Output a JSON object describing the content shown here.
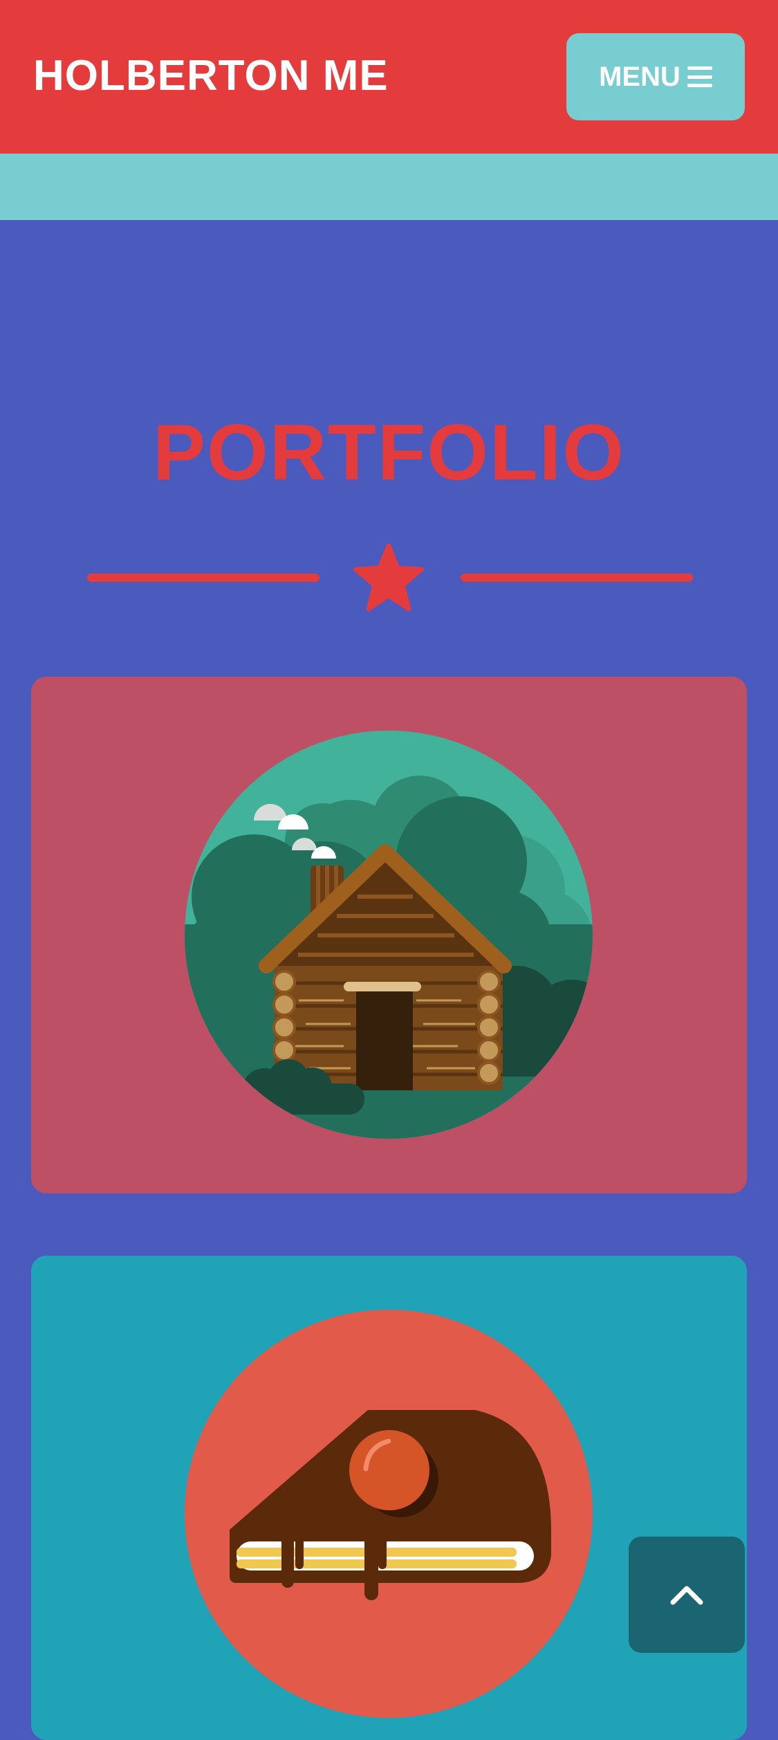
{
  "navbar": {
    "brand": "HOLBERTON ME",
    "menu_label": "MENU",
    "menu_icon": "bars-icon"
  },
  "portfolio": {
    "title": "PORTFOLIO",
    "divider_icon": "star-icon",
    "items": [
      {
        "image": "log-cabin-illustration",
        "background": "#bd5065"
      },
      {
        "image": "cake-slice-illustration",
        "background": "#21a3b7"
      }
    ]
  },
  "scroll_top": {
    "icon": "chevron-up-icon"
  },
  "colors": {
    "primary": "#e43c3c",
    "secondary": "#78cdd1",
    "background": "#4a5bbd",
    "dark_teal": "#1b6471"
  }
}
